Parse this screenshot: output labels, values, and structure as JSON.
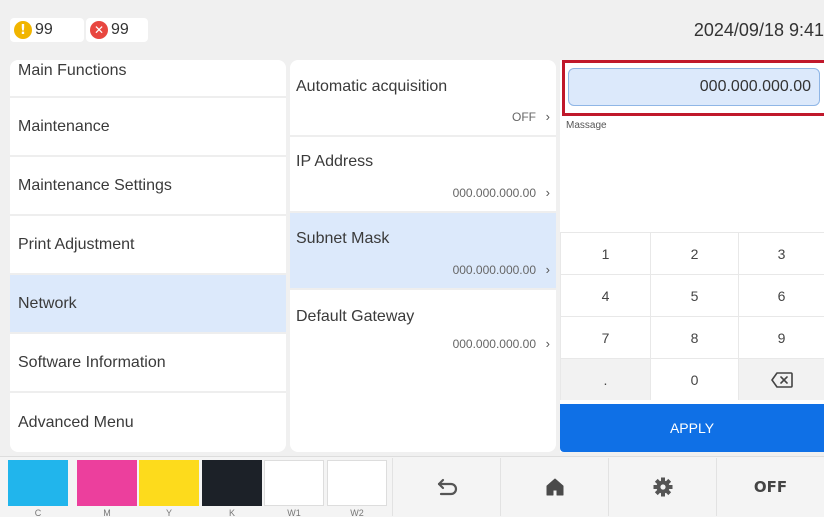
{
  "status_bar": {
    "warning_count": "99",
    "error_count": "99",
    "datetime": "2024/09/18 9:41"
  },
  "left_menu": [
    {
      "label": "Main Functions",
      "active": false
    },
    {
      "label": "Maintenance",
      "active": false
    },
    {
      "label": "Maintenance Settings",
      "active": false
    },
    {
      "label": "Print Adjustment",
      "active": false
    },
    {
      "label": "Network",
      "active": true
    },
    {
      "label": "Software Information",
      "active": false
    },
    {
      "label": "Advanced Menu",
      "active": false
    }
  ],
  "network_settings": [
    {
      "title": "Automatic acquisition",
      "value": "OFF",
      "active": false
    },
    {
      "title": "IP Address",
      "value": "000.000.000.00",
      "active": false
    },
    {
      "title": "Subnet Mask",
      "value": "000.000.000.00",
      "active": true
    },
    {
      "title": "Default Gateway",
      "value": "000.000.000.00",
      "active": false
    }
  ],
  "input": {
    "value": "000.000.000.00",
    "message_label": "Massage"
  },
  "keypad": {
    "keys": [
      "1",
      "2",
      "3",
      "4",
      "5",
      "6",
      "7",
      "8",
      "9",
      ".",
      "0",
      "backspace-icon"
    ],
    "apply_label": "APPLY"
  },
  "inks": [
    {
      "label": "C",
      "color": "#21b5ec"
    },
    {
      "label": "M",
      "color": "#ec3f9d"
    },
    {
      "label": "Y",
      "color": "#fddb1c"
    },
    {
      "label": "K",
      "color": "#1c2128"
    },
    {
      "label": "W1",
      "color": "#ffffff"
    },
    {
      "label": "W2",
      "color": "#ffffff"
    }
  ],
  "bottom_buttons": {
    "back": "back-arrow-icon",
    "home": "home-icon",
    "settings": "gear-icon",
    "power_label": "OFF"
  },
  "colors": {
    "accent": "#0f70e6",
    "selected_bg": "#dce9fb",
    "highlight_border": "#c0182b",
    "warning": "#f1b500",
    "error": "#e8463f"
  }
}
